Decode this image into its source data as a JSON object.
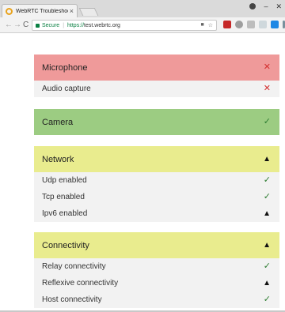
{
  "browser": {
    "tab_title": "WebRTC Troubleshooter",
    "tab_close": "×",
    "secure_label": "Secure",
    "url_scheme": "https://",
    "url_rest": "test.webrtc.org",
    "nav_back": "←",
    "nav_forward": "→",
    "nav_reload": "C",
    "minimize": "–",
    "close": "✕",
    "star_glyph": "☆",
    "camera_glyph": "■"
  },
  "colors": {
    "fail": "#ef9a9a",
    "ok": "#9ccc82",
    "warn": "#e9ec8e"
  },
  "sections": [
    {
      "title": "Microphone",
      "status": "fail",
      "glyph": "✕",
      "items": [
        {
          "label": "Audio capture",
          "status": "fail",
          "glyph": "✕"
        }
      ]
    },
    {
      "title": "Camera",
      "status": "ok",
      "glyph": "✓",
      "items": []
    },
    {
      "title": "Network",
      "status": "warn",
      "glyph": "▲",
      "items": [
        {
          "label": "Udp enabled",
          "status": "ok",
          "glyph": "✓"
        },
        {
          "label": "Tcp enabled",
          "status": "ok",
          "glyph": "✓"
        },
        {
          "label": "Ipv6 enabled",
          "status": "warn",
          "glyph": "▲"
        }
      ]
    },
    {
      "title": "Connectivity",
      "status": "warn",
      "glyph": "▲",
      "items": [
        {
          "label": "Relay connectivity",
          "status": "ok",
          "glyph": "✓"
        },
        {
          "label": "Reflexive connectivity",
          "status": "warn",
          "glyph": "▲"
        },
        {
          "label": "Host connectivity",
          "status": "ok",
          "glyph": "✓"
        }
      ]
    }
  ]
}
